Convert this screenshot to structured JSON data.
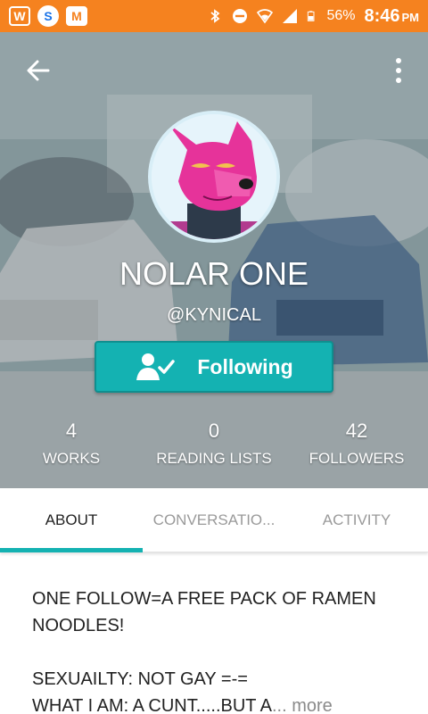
{
  "status_bar": {
    "apps": [
      "W",
      "S",
      "M"
    ],
    "battery": "56%",
    "time": "8:46",
    "ampm": "PM",
    "icons": [
      "bluetooth-icon",
      "do-not-disturb-icon",
      "wifi-icon",
      "signal-icon",
      "battery-icon"
    ]
  },
  "header": {
    "back_icon": "arrow-left-icon",
    "more_icon": "more-vertical-icon"
  },
  "profile": {
    "name": "NOLAR ONE",
    "handle": "@KYNICAL",
    "follow_label": "Following"
  },
  "stats": [
    {
      "value": "4",
      "label": "WORKS"
    },
    {
      "value": "0",
      "label": "READING LISTS"
    },
    {
      "value": "42",
      "label": "FOLLOWERS"
    }
  ],
  "tabs": [
    {
      "label": "ABOUT",
      "active": true
    },
    {
      "label": "CONVERSATIO...",
      "active": false
    },
    {
      "label": "ACTIVITY",
      "active": false
    }
  ],
  "about": {
    "line1": "ONE FOLLOW=A FREE PACK OF RAMEN NOODLES!",
    "line2": "SEXUAILTY: NOT GAY =-=",
    "line3": "WHAT I AM: A CUNT.....BUT A",
    "ellipsis": "...",
    "more_label": "more"
  },
  "colors": {
    "status_bar": "#f5821f",
    "accent": "#14b2b2",
    "avatar_fur": "#e6339a"
  }
}
